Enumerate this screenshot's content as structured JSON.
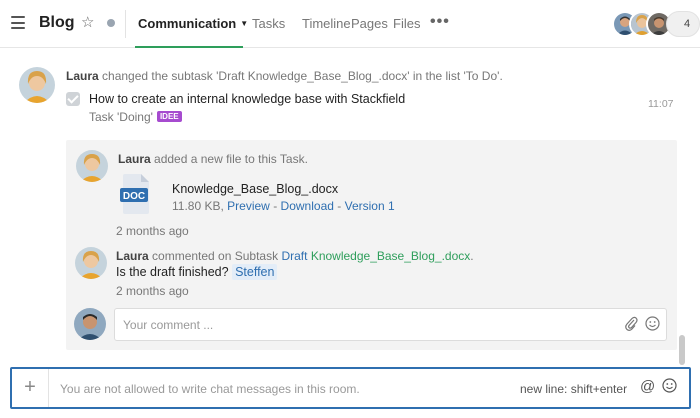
{
  "header": {
    "title": "Blog",
    "tabs": [
      {
        "label": "Communication"
      },
      {
        "label": "Tasks"
      },
      {
        "label": "Timeline"
      },
      {
        "label": "Pages"
      },
      {
        "label": "Files"
      }
    ],
    "more": "•••",
    "member_count": "4",
    "accent_color": "#2e9e5b"
  },
  "activity": {
    "user": "Laura",
    "action_text": "changed the subtask 'Draft Knowledge_Base_Blog_.docx' in the list 'To Do'.",
    "subtask_title": "How to create an internal knowledge base with Stackfield",
    "task_status": "Task 'Doing'",
    "tag": "IDEE",
    "time": "11:07"
  },
  "file_event": {
    "user": "Laura",
    "action_text": "added a new file to this Task.",
    "file_type": "DOC",
    "file_name": "Knowledge_Base_Blog_.docx",
    "file_size": "11.80 KB,",
    "preview_label": "Preview",
    "download_label": "Download",
    "version_label": "Version 1",
    "time_ago": "2 months ago"
  },
  "comment_event": {
    "user": "Laura",
    "action_text": "commented on Subtask",
    "subtask_link": "Draft",
    "subtask_name": "Knowledge_Base_Blog_.docx",
    "period": ".",
    "comment": "Is the draft finished?",
    "mention": "Steffen",
    "time_ago": "2 months ago"
  },
  "comment_input": {
    "placeholder": "Your comment ..."
  },
  "composer": {
    "plus": "+",
    "placeholder": "You are not allowed to write chat messages in this room.",
    "hint": "new line: shift+enter",
    "at": "@",
    "emoji": "☺"
  }
}
